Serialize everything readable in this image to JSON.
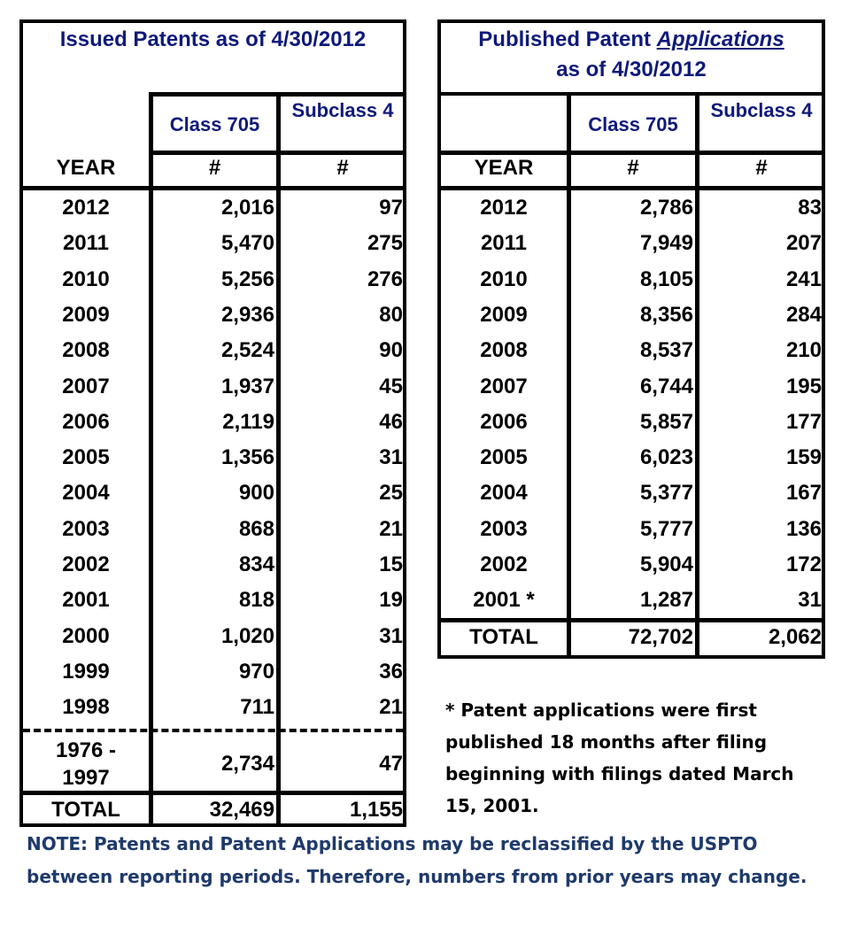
{
  "issued": {
    "title": "Issued Patents as of 4/30/2012",
    "col_class": "Class 705",
    "col_subclass": "Subclass 4",
    "col_year": "YEAR",
    "col_hash1": "#",
    "col_hash2": "#",
    "rows": [
      {
        "year": "2012",
        "class705": "2,016",
        "subclass4": "97"
      },
      {
        "year": "2011",
        "class705": "5,470",
        "subclass4": "275"
      },
      {
        "year": "2010",
        "class705": "5,256",
        "subclass4": "276"
      },
      {
        "year": "2009",
        "class705": "2,936",
        "subclass4": "80"
      },
      {
        "year": "2008",
        "class705": "2,524",
        "subclass4": "90"
      },
      {
        "year": "2007",
        "class705": "1,937",
        "subclass4": "45"
      },
      {
        "year": "2006",
        "class705": "2,119",
        "subclass4": "46"
      },
      {
        "year": "2005",
        "class705": "1,356",
        "subclass4": "31"
      },
      {
        "year": "2004",
        "class705": "900",
        "subclass4": "25"
      },
      {
        "year": "2003",
        "class705": "868",
        "subclass4": "21"
      },
      {
        "year": "2002",
        "class705": "834",
        "subclass4": "15"
      },
      {
        "year": "2001",
        "class705": "818",
        "subclass4": "19"
      },
      {
        "year": "2000",
        "class705": "1,020",
        "subclass4": "31"
      },
      {
        "year": "1999",
        "class705": "970",
        "subclass4": "36"
      },
      {
        "year": "1998",
        "class705": "711",
        "subclass4": "21"
      }
    ],
    "range_row": {
      "year_line1": "1976 -",
      "year_line2": "1997",
      "class705": "2,734",
      "subclass4": "47"
    },
    "total": {
      "label": "TOTAL",
      "class705": "32,469",
      "subclass4": "1,155"
    }
  },
  "published": {
    "title_part1": "Published Patent ",
    "title_emph": "Applications",
    "title_line2": "as of 4/30/2012",
    "col_class": "Class 705",
    "col_subclass": "Subclass 4",
    "col_year": "YEAR",
    "col_hash1": "#",
    "col_hash2": "#",
    "rows": [
      {
        "year": "2012",
        "class705": "2,786",
        "subclass4": "83"
      },
      {
        "year": "2011",
        "class705": "7,949",
        "subclass4": "207"
      },
      {
        "year": "2010",
        "class705": "8,105",
        "subclass4": "241"
      },
      {
        "year": "2009",
        "class705": "8,356",
        "subclass4": "284"
      },
      {
        "year": "2008",
        "class705": "8,537",
        "subclass4": "210"
      },
      {
        "year": "2007",
        "class705": "6,744",
        "subclass4": "195"
      },
      {
        "year": "2006",
        "class705": "5,857",
        "subclass4": "177"
      },
      {
        "year": "2005",
        "class705": "6,023",
        "subclass4": "159"
      },
      {
        "year": "2004",
        "class705": "5,377",
        "subclass4": "167"
      },
      {
        "year": "2003",
        "class705": "5,777",
        "subclass4": "136"
      },
      {
        "year": "2002",
        "class705": "5,904",
        "subclass4": "172"
      },
      {
        "year": "2001 *",
        "class705": "1,287",
        "subclass4": "31"
      }
    ],
    "total": {
      "label": "TOTAL",
      "class705": "72,702",
      "subclass4": "2,062"
    }
  },
  "footnote": "* Patent applications were first published 18 months after filing beginning with filings dated March 15, 2001.",
  "note": "NOTE: Patents and Patent Applications may be reclassified by the USPTO between reporting periods.  Therefore, numbers from prior years may change.",
  "colors": {
    "title_blue": "#0f1a7a",
    "note_blue": "#1f3a6b"
  }
}
